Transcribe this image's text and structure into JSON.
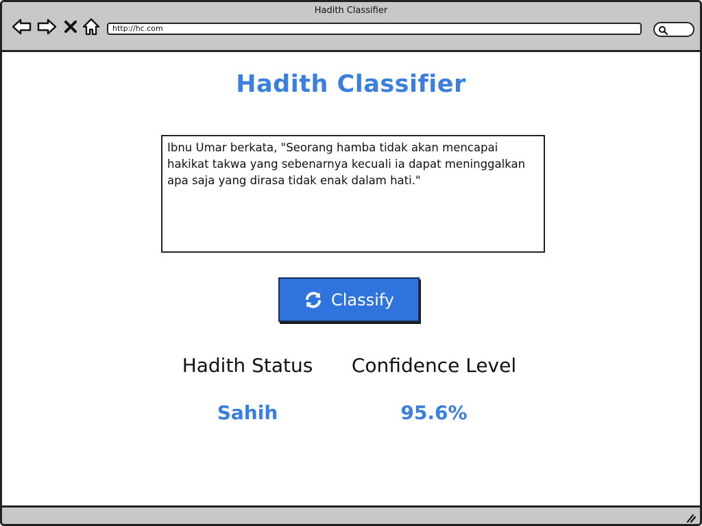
{
  "window": {
    "title": "Hadith Classifier",
    "url": "http://hc.com"
  },
  "nav": {
    "back_icon": "arrow-left-icon",
    "forward_icon": "arrow-right-icon",
    "stop_icon": "close-icon",
    "home_icon": "home-icon",
    "search_icon": "search-icon"
  },
  "main": {
    "title": "Hadith Classifier",
    "input_text": "Ibnu Umar berkata, \"Seorang hamba tidak akan mencapai hakikat takwa yang sebenarnya kecuali ia dapat meninggalkan apa saja yang dirasa tidak enak dalam hati.\"",
    "classify_label": "Classify",
    "classify_icon": "refresh-icon"
  },
  "results": {
    "status_label": "Hadith Status",
    "status_value": "Sahih",
    "confidence_label": "Confidence Level",
    "confidence_value": "95.6%"
  },
  "colors": {
    "accent": "#3a7ee0",
    "button": "#2f74dd",
    "chrome": "#c8c8c8"
  }
}
